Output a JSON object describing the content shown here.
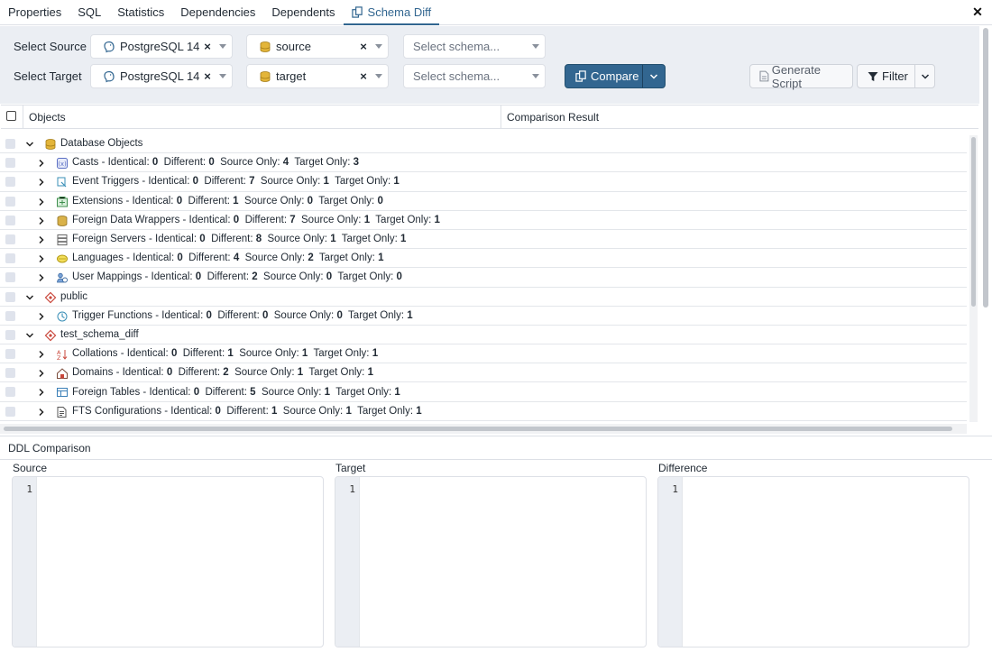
{
  "tabs": [
    {
      "label": "Properties",
      "active": false
    },
    {
      "label": "SQL",
      "active": false
    },
    {
      "label": "Statistics",
      "active": false
    },
    {
      "label": "Dependencies",
      "active": false
    },
    {
      "label": "Dependents",
      "active": false
    },
    {
      "label": "Schema Diff",
      "active": true,
      "icon": "schema-diff-icon"
    }
  ],
  "close_label": "✕",
  "source": {
    "label": "Select Source",
    "server": "PostgreSQL 14",
    "database": "source",
    "schema_placeholder": "Select schema..."
  },
  "target": {
    "label": "Select Target",
    "server": "PostgreSQL 14",
    "database": "target",
    "schema_placeholder": "Select schema..."
  },
  "buttons": {
    "compare": "Compare",
    "generate_script": "Generate Script",
    "filter": "Filter"
  },
  "table": {
    "col_objects": "Objects",
    "col_result": "Comparison Result"
  },
  "rows": [
    {
      "level": 0,
      "label": "Database Objects",
      "icon": "database-icon",
      "counts": null
    },
    {
      "level": 1,
      "label": "Casts - Identical:",
      "icon": "casts-icon",
      "counts": [
        "0",
        "0",
        "4",
        "3"
      ]
    },
    {
      "level": 1,
      "label": "Event Triggers - Identical:",
      "icon": "event-trigger-icon",
      "counts": [
        "0",
        "7",
        "1",
        "1"
      ]
    },
    {
      "level": 1,
      "label": "Extensions - Identical:",
      "icon": "extension-icon",
      "counts": [
        "0",
        "1",
        "0",
        "0"
      ]
    },
    {
      "level": 1,
      "label": "Foreign Data Wrappers - Identical:",
      "icon": "fdw-icon",
      "counts": [
        "0",
        "7",
        "1",
        "1"
      ]
    },
    {
      "level": 1,
      "label": "Foreign Servers - Identical:",
      "icon": "foreign-server-icon",
      "counts": [
        "0",
        "8",
        "1",
        "1"
      ]
    },
    {
      "level": 1,
      "label": "Languages - Identical:",
      "icon": "language-icon",
      "counts": [
        "0",
        "4",
        "2",
        "1"
      ]
    },
    {
      "level": 1,
      "label": "User Mappings - Identical:",
      "icon": "user-mapping-icon",
      "counts": [
        "0",
        "2",
        "0",
        "0"
      ]
    },
    {
      "level": 0,
      "label": "public",
      "icon": "schema-icon",
      "counts": null
    },
    {
      "level": 1,
      "label": "Trigger Functions - Identical:",
      "icon": "trigger-function-icon",
      "counts": [
        "0",
        "0",
        "0",
        "1"
      ]
    },
    {
      "level": 0,
      "label": "test_schema_diff",
      "icon": "schema-icon",
      "counts": null
    },
    {
      "level": 1,
      "label": "Collations - Identical:",
      "icon": "collation-icon",
      "counts": [
        "0",
        "1",
        "1",
        "1"
      ]
    },
    {
      "level": 1,
      "label": "Domains - Identical:",
      "icon": "domain-icon",
      "counts": [
        "0",
        "2",
        "1",
        "1"
      ]
    },
    {
      "level": 1,
      "label": "Foreign Tables - Identical:",
      "icon": "foreign-table-icon",
      "counts": [
        "0",
        "5",
        "1",
        "1"
      ]
    },
    {
      "level": 1,
      "label": "FTS Configurations - Identical:",
      "icon": "fts-config-icon",
      "counts": [
        "0",
        "1",
        "1",
        "1"
      ]
    }
  ],
  "count_labels": [
    "Different:",
    "Source Only:",
    "Target Only:"
  ],
  "ddl": {
    "title": "DDL Comparison",
    "source": "Source",
    "target": "Target",
    "difference": "Difference",
    "line_number": "1"
  },
  "colors": {
    "accent": "#326690",
    "toolbar_bg": "#ebeef3",
    "border": "#dde0e6"
  }
}
